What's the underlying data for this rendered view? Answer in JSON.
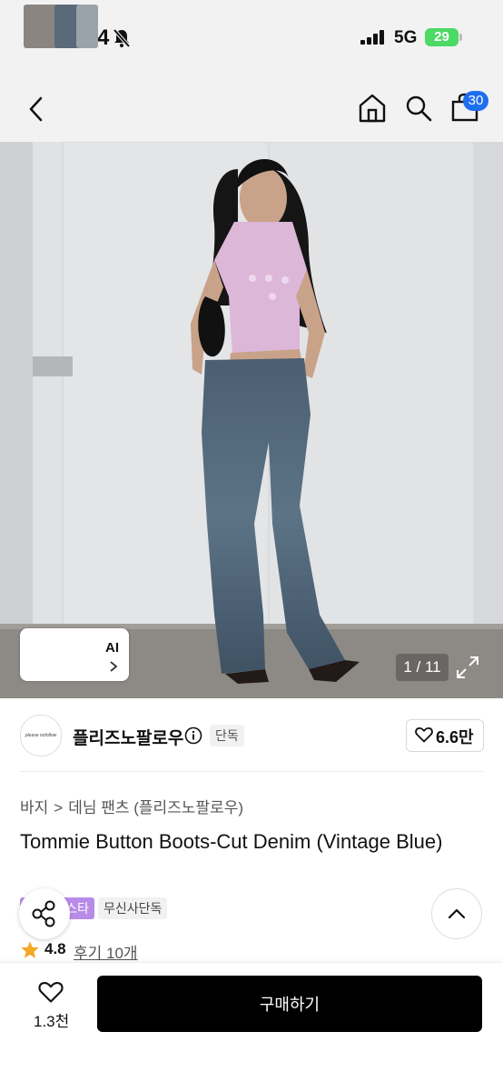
{
  "status_bar": {
    "time": "12:24",
    "network": "5G",
    "battery": "29"
  },
  "header": {
    "cart_count": "30",
    "icons": [
      "back-chevron-icon",
      "home-icon",
      "search-icon",
      "shopping-bag-icon"
    ]
  },
  "gallery": {
    "ai_label": "AI",
    "counter": "1 / 11"
  },
  "brand": {
    "logo_text": "please nofollow",
    "name": "플리즈노팔로우",
    "badge": "단독",
    "likes": "6.6만"
  },
  "product": {
    "breadcrumb": [
      "바지",
      "데님 팬츠 (플리즈노팔로우)"
    ],
    "title": "Tommie Button Boots-Cut Denim (Vintage Blue)",
    "tags": [
      "스타",
      "무신사단독"
    ],
    "rating": "4.8",
    "reviews": "후기 10개"
  },
  "bottom_bar": {
    "wish_count": "1.3천",
    "buy_label": "구매하기"
  },
  "colors": {
    "accent_blue": "#1e6ef0",
    "battery_green": "#4cd964",
    "tag_purple": "#b98be8",
    "buy_black": "#000000"
  }
}
